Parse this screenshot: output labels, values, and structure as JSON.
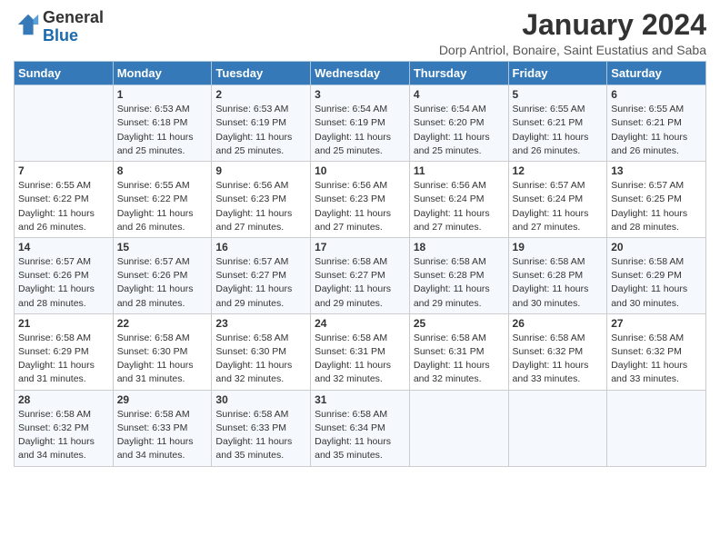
{
  "logo": {
    "line1": "General",
    "line2": "Blue"
  },
  "title": "January 2024",
  "subtitle": "Dorp Antriol, Bonaire, Saint Eustatius and Saba",
  "headers": [
    "Sunday",
    "Monday",
    "Tuesday",
    "Wednesday",
    "Thursday",
    "Friday",
    "Saturday"
  ],
  "weeks": [
    [
      {
        "day": "",
        "sunrise": "",
        "sunset": "",
        "daylight": ""
      },
      {
        "day": "1",
        "sunrise": "Sunrise: 6:53 AM",
        "sunset": "Sunset: 6:18 PM",
        "daylight": "Daylight: 11 hours and 25 minutes."
      },
      {
        "day": "2",
        "sunrise": "Sunrise: 6:53 AM",
        "sunset": "Sunset: 6:19 PM",
        "daylight": "Daylight: 11 hours and 25 minutes."
      },
      {
        "day": "3",
        "sunrise": "Sunrise: 6:54 AM",
        "sunset": "Sunset: 6:19 PM",
        "daylight": "Daylight: 11 hours and 25 minutes."
      },
      {
        "day": "4",
        "sunrise": "Sunrise: 6:54 AM",
        "sunset": "Sunset: 6:20 PM",
        "daylight": "Daylight: 11 hours and 25 minutes."
      },
      {
        "day": "5",
        "sunrise": "Sunrise: 6:55 AM",
        "sunset": "Sunset: 6:21 PM",
        "daylight": "Daylight: 11 hours and 26 minutes."
      },
      {
        "day": "6",
        "sunrise": "Sunrise: 6:55 AM",
        "sunset": "Sunset: 6:21 PM",
        "daylight": "Daylight: 11 hours and 26 minutes."
      }
    ],
    [
      {
        "day": "7",
        "sunrise": "Sunrise: 6:55 AM",
        "sunset": "Sunset: 6:22 PM",
        "daylight": "Daylight: 11 hours and 26 minutes."
      },
      {
        "day": "8",
        "sunrise": "Sunrise: 6:55 AM",
        "sunset": "Sunset: 6:22 PM",
        "daylight": "Daylight: 11 hours and 26 minutes."
      },
      {
        "day": "9",
        "sunrise": "Sunrise: 6:56 AM",
        "sunset": "Sunset: 6:23 PM",
        "daylight": "Daylight: 11 hours and 27 minutes."
      },
      {
        "day": "10",
        "sunrise": "Sunrise: 6:56 AM",
        "sunset": "Sunset: 6:23 PM",
        "daylight": "Daylight: 11 hours and 27 minutes."
      },
      {
        "day": "11",
        "sunrise": "Sunrise: 6:56 AM",
        "sunset": "Sunset: 6:24 PM",
        "daylight": "Daylight: 11 hours and 27 minutes."
      },
      {
        "day": "12",
        "sunrise": "Sunrise: 6:57 AM",
        "sunset": "Sunset: 6:24 PM",
        "daylight": "Daylight: 11 hours and 27 minutes."
      },
      {
        "day": "13",
        "sunrise": "Sunrise: 6:57 AM",
        "sunset": "Sunset: 6:25 PM",
        "daylight": "Daylight: 11 hours and 28 minutes."
      }
    ],
    [
      {
        "day": "14",
        "sunrise": "Sunrise: 6:57 AM",
        "sunset": "Sunset: 6:26 PM",
        "daylight": "Daylight: 11 hours and 28 minutes."
      },
      {
        "day": "15",
        "sunrise": "Sunrise: 6:57 AM",
        "sunset": "Sunset: 6:26 PM",
        "daylight": "Daylight: 11 hours and 28 minutes."
      },
      {
        "day": "16",
        "sunrise": "Sunrise: 6:57 AM",
        "sunset": "Sunset: 6:27 PM",
        "daylight": "Daylight: 11 hours and 29 minutes."
      },
      {
        "day": "17",
        "sunrise": "Sunrise: 6:58 AM",
        "sunset": "Sunset: 6:27 PM",
        "daylight": "Daylight: 11 hours and 29 minutes."
      },
      {
        "day": "18",
        "sunrise": "Sunrise: 6:58 AM",
        "sunset": "Sunset: 6:28 PM",
        "daylight": "Daylight: 11 hours and 29 minutes."
      },
      {
        "day": "19",
        "sunrise": "Sunrise: 6:58 AM",
        "sunset": "Sunset: 6:28 PM",
        "daylight": "Daylight: 11 hours and 30 minutes."
      },
      {
        "day": "20",
        "sunrise": "Sunrise: 6:58 AM",
        "sunset": "Sunset: 6:29 PM",
        "daylight": "Daylight: 11 hours and 30 minutes."
      }
    ],
    [
      {
        "day": "21",
        "sunrise": "Sunrise: 6:58 AM",
        "sunset": "Sunset: 6:29 PM",
        "daylight": "Daylight: 11 hours and 31 minutes."
      },
      {
        "day": "22",
        "sunrise": "Sunrise: 6:58 AM",
        "sunset": "Sunset: 6:30 PM",
        "daylight": "Daylight: 11 hours and 31 minutes."
      },
      {
        "day": "23",
        "sunrise": "Sunrise: 6:58 AM",
        "sunset": "Sunset: 6:30 PM",
        "daylight": "Daylight: 11 hours and 32 minutes."
      },
      {
        "day": "24",
        "sunrise": "Sunrise: 6:58 AM",
        "sunset": "Sunset: 6:31 PM",
        "daylight": "Daylight: 11 hours and 32 minutes."
      },
      {
        "day": "25",
        "sunrise": "Sunrise: 6:58 AM",
        "sunset": "Sunset: 6:31 PM",
        "daylight": "Daylight: 11 hours and 32 minutes."
      },
      {
        "day": "26",
        "sunrise": "Sunrise: 6:58 AM",
        "sunset": "Sunset: 6:32 PM",
        "daylight": "Daylight: 11 hours and 33 minutes."
      },
      {
        "day": "27",
        "sunrise": "Sunrise: 6:58 AM",
        "sunset": "Sunset: 6:32 PM",
        "daylight": "Daylight: 11 hours and 33 minutes."
      }
    ],
    [
      {
        "day": "28",
        "sunrise": "Sunrise: 6:58 AM",
        "sunset": "Sunset: 6:32 PM",
        "daylight": "Daylight: 11 hours and 34 minutes."
      },
      {
        "day": "29",
        "sunrise": "Sunrise: 6:58 AM",
        "sunset": "Sunset: 6:33 PM",
        "daylight": "Daylight: 11 hours and 34 minutes."
      },
      {
        "day": "30",
        "sunrise": "Sunrise: 6:58 AM",
        "sunset": "Sunset: 6:33 PM",
        "daylight": "Daylight: 11 hours and 35 minutes."
      },
      {
        "day": "31",
        "sunrise": "Sunrise: 6:58 AM",
        "sunset": "Sunset: 6:34 PM",
        "daylight": "Daylight: 11 hours and 35 minutes."
      },
      {
        "day": "",
        "sunrise": "",
        "sunset": "",
        "daylight": ""
      },
      {
        "day": "",
        "sunrise": "",
        "sunset": "",
        "daylight": ""
      },
      {
        "day": "",
        "sunrise": "",
        "sunset": "",
        "daylight": ""
      }
    ]
  ]
}
